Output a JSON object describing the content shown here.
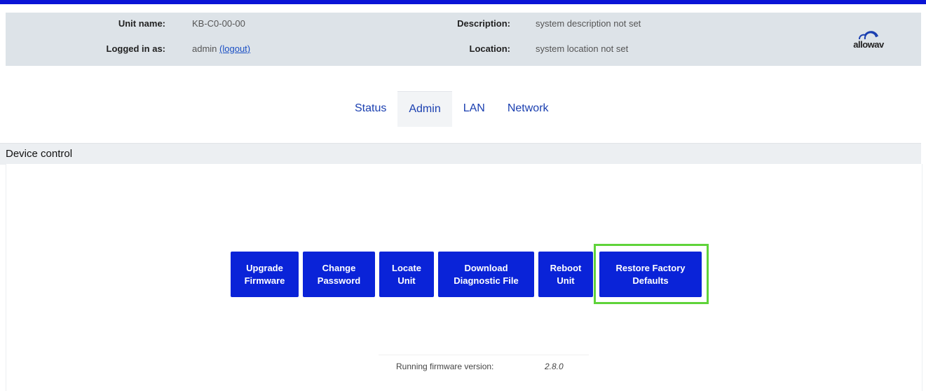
{
  "header": {
    "unit_name_label": "Unit name:",
    "unit_name_value": "KB-C0-00-00",
    "logged_in_label": "Logged in as:",
    "logged_in_user": "admin",
    "logout_link": "(logout)",
    "description_label": "Description:",
    "description_value": "system description not set",
    "location_label": "Location:",
    "location_value": "system location not set",
    "logo_text": "allowav"
  },
  "tabs": [
    {
      "label": "Status",
      "active": false
    },
    {
      "label": "Admin",
      "active": true
    },
    {
      "label": "LAN",
      "active": false
    },
    {
      "label": "Network",
      "active": false
    }
  ],
  "section": {
    "title": "Device control"
  },
  "buttons": {
    "upgrade_firmware": [
      "Upgrade",
      "Firmware"
    ],
    "change_password": [
      "Change",
      "Password"
    ],
    "locate_unit": [
      "Locate",
      "Unit"
    ],
    "download_diagnostic": [
      "Download",
      "Diagnostic File"
    ],
    "reboot_unit": [
      "Reboot",
      "Unit"
    ],
    "restore_factory": [
      "Restore Factory",
      "Defaults"
    ]
  },
  "firmware": {
    "label": "Running firmware version:",
    "value": "2.8.0"
  },
  "colors": {
    "accent_bar": "#0a14d6",
    "button": "#0a23d8",
    "highlight": "#5fd33a",
    "header_bg": "#dde3e8"
  }
}
